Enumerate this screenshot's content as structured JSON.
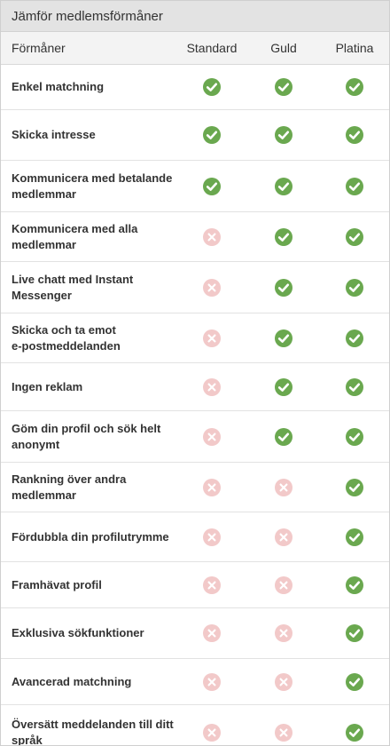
{
  "title": "Jämför medlemsförmåner",
  "columns": {
    "feature": "Förmåner",
    "standard": "Standard",
    "guld": "Guld",
    "platina": "Platina"
  },
  "colors": {
    "check": "#6aa84f",
    "cross": "#f2c9c9"
  },
  "rows": [
    {
      "label": "Enkel matchning",
      "standard": true,
      "guld": true,
      "platina": true
    },
    {
      "label": "Skicka intresse",
      "standard": true,
      "guld": true,
      "platina": true
    },
    {
      "label": "Kommunicera med betalande\nmedlemmar",
      "standard": true,
      "guld": true,
      "platina": true
    },
    {
      "label": "Kommunicera med alla\nmedlemmar",
      "standard": false,
      "guld": true,
      "platina": true
    },
    {
      "label": "Live chatt med Instant Messenger",
      "standard": false,
      "guld": true,
      "platina": true
    },
    {
      "label": "Skicka och ta emot\ne-postmeddelanden",
      "standard": false,
      "guld": true,
      "platina": true
    },
    {
      "label": "Ingen reklam",
      "standard": false,
      "guld": true,
      "platina": true
    },
    {
      "label": "Göm din profil och sök helt\nanonymt",
      "standard": false,
      "guld": true,
      "platina": true
    },
    {
      "label": "Rankning över andra medlemmar",
      "standard": false,
      "guld": false,
      "platina": true
    },
    {
      "label": "Fördubbla din profilutrymme",
      "standard": false,
      "guld": false,
      "platina": true
    },
    {
      "label": "Framhävat profil",
      "standard": false,
      "guld": false,
      "platina": true
    },
    {
      "label": "Exklusiva sökfunktioner",
      "standard": false,
      "guld": false,
      "platina": true
    },
    {
      "label": "Avancerad matchning",
      "standard": false,
      "guld": false,
      "platina": true
    },
    {
      "label": "Översätt meddelanden till ditt\nspråk",
      "standard": false,
      "guld": false,
      "platina": true
    }
  ]
}
